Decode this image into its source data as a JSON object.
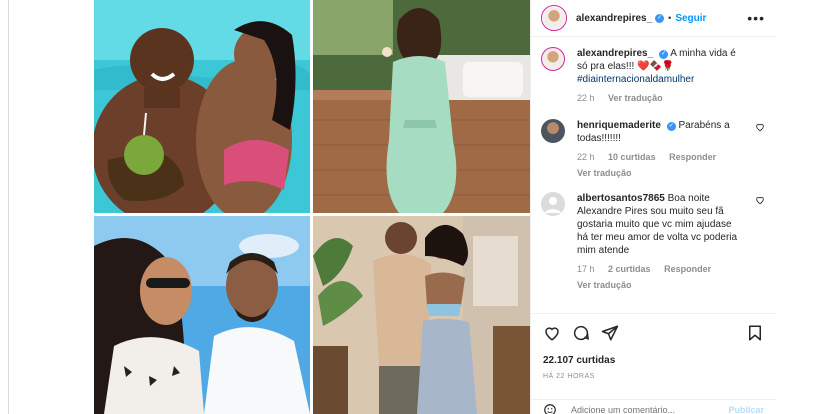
{
  "post": {
    "author": "alexandrepires_",
    "follow_label": "Seguir",
    "more_label": "•••",
    "verified_mark": "✓",
    "separator": "•"
  },
  "caption": {
    "username": "alexandrepires_",
    "text": "A minha vida é só pra elas!!! ❤️🍫🌹",
    "hashtag": "#diainternacionaldamulher",
    "age": "22 h",
    "translate": "Ver tradução"
  },
  "comments": [
    {
      "username": "henriquemaderite",
      "text": "Parabéns a todas!!!!!!!",
      "age": "22 h",
      "likes": "10 curtidas",
      "reply": "Responder",
      "translate": "Ver tradução"
    },
    {
      "username": "albertosantos7865",
      "text": "Boa noite Alexandre Pires sou muito seu fã gostaria muito que vc mim ajudase há ter meu amor de volta vc poderia mim atende",
      "age": "17 h",
      "likes": "2 curtidas",
      "reply": "Responder",
      "translate": "Ver tradução"
    }
  ],
  "stats": {
    "likes": "22.107 curtidas",
    "posted": "HÁ 22 HORAS"
  },
  "composer": {
    "placeholder": "Adicione um comentário...",
    "publish": "Publicar"
  },
  "icons": {
    "like": "heart-icon",
    "comment": "comment-icon",
    "share": "paper-plane-icon",
    "save": "bookmark-icon",
    "emoji": "emoji-icon"
  },
  "colors": {
    "link": "#0095f6",
    "verified": "#3897f0",
    "hashtag": "#00376b",
    "muted": "#8e8e8e"
  }
}
